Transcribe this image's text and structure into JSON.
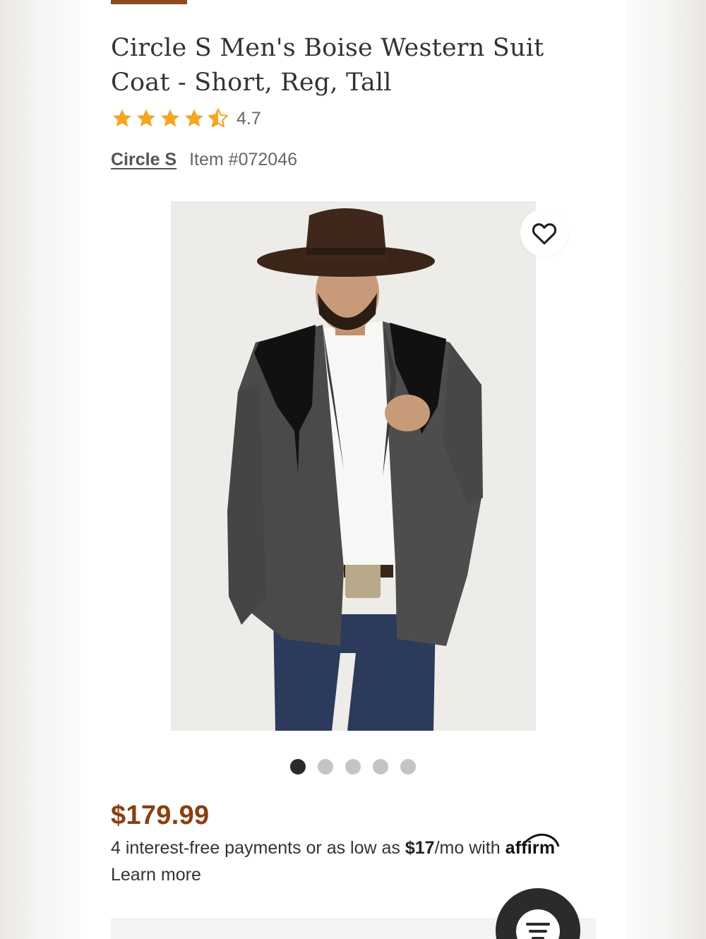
{
  "product": {
    "title": "Circle S Men's Boise Western Suit Coat - Short, Reg, Tall",
    "rating_value": "4.7",
    "rating": 4.7,
    "brand": "Circle S",
    "item_number": "Item #072046",
    "image_alt": "Man in cowboy hat wearing gray western suit coat with black yokes",
    "price": "$179.99"
  },
  "carousel": {
    "total": 5,
    "active_index": 0
  },
  "financing": {
    "prefix": "4 interest-free payments or as low as ",
    "amount": "$17",
    "suffix": "/mo with ",
    "provider": "affirm",
    "learn_more": "Learn more"
  },
  "colors": {
    "star": "#f5a623",
    "price": "#8a3f12",
    "accent": "#8a4b1e",
    "dot_active": "#2a2a2a",
    "dot_inactive": "#c4c4c4"
  },
  "icons": {
    "favorite": "heart-icon",
    "chat": "chat-menu-icon"
  }
}
